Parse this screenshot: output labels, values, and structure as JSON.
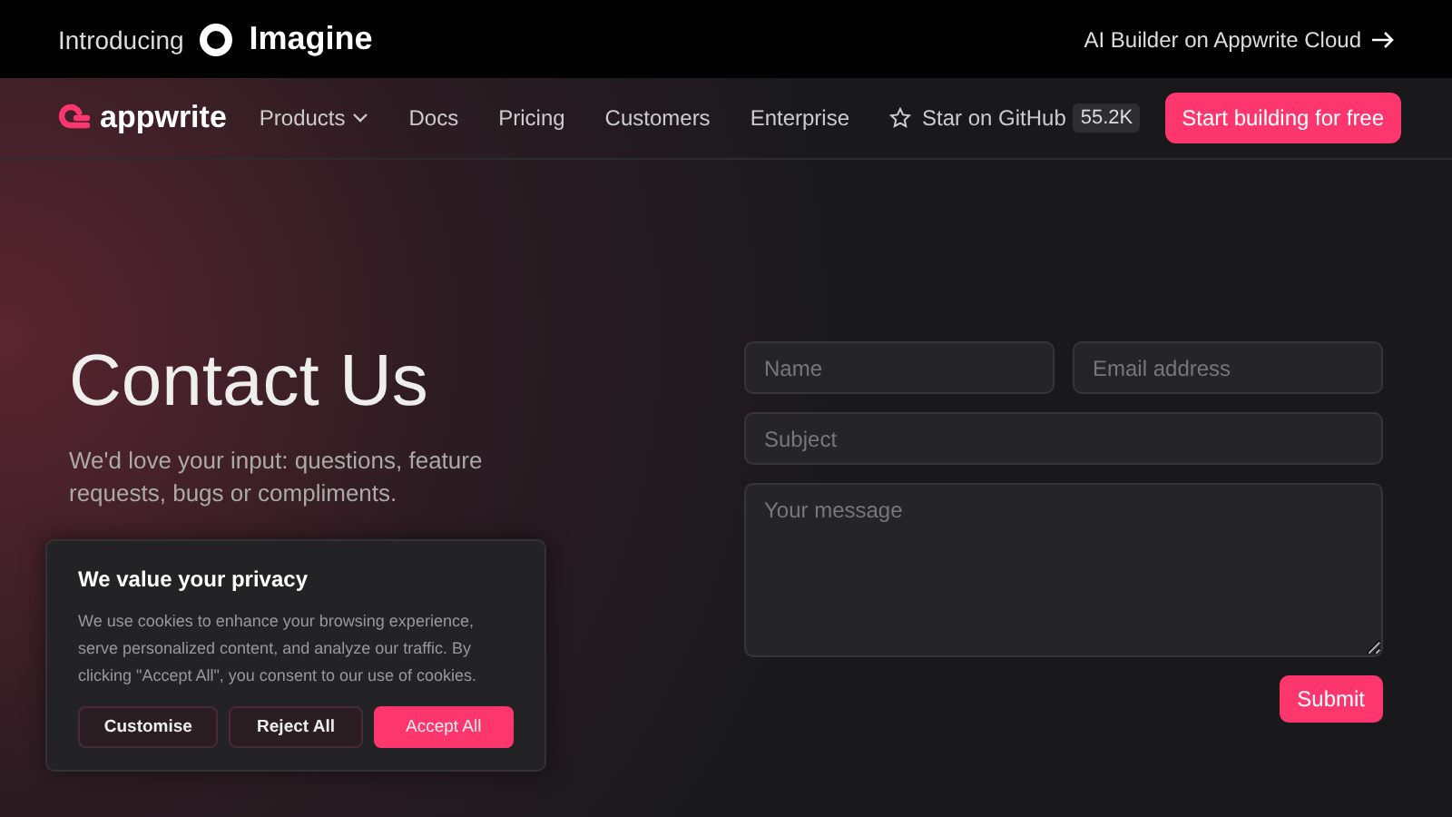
{
  "announcement": {
    "intro": "Introducing",
    "product": "Imagine",
    "link": "AI Builder on Appwrite Cloud"
  },
  "nav": {
    "logo": "appwrite",
    "items": [
      {
        "label": "Products",
        "dropdown": true
      },
      {
        "label": "Docs",
        "dropdown": false
      },
      {
        "label": "Pricing",
        "dropdown": false
      },
      {
        "label": "Customers",
        "dropdown": false
      },
      {
        "label": "Enterprise",
        "dropdown": false
      }
    ],
    "github": {
      "label": "Star on GitHub",
      "count": "55.2K"
    },
    "cta": "Start building for free"
  },
  "hero": {
    "title": "Contact Us",
    "subtitle": "We'd love your input: questions, feature requests, bugs or compliments."
  },
  "form": {
    "fields": [
      {
        "kind": "input",
        "placeholder": "Name"
      },
      {
        "kind": "input",
        "placeholder": "Email address"
      },
      {
        "kind": "input",
        "placeholder": "Subject"
      },
      {
        "kind": "textarea",
        "placeholder": "Your message"
      }
    ],
    "submit": "Submit"
  },
  "cookie_banner": {
    "title": "We value your privacy",
    "text": "We use cookies to enhance your browsing experience, serve personalized content, and analyze our traffic. By clicking \"Accept All\", you consent to our use of cookies.",
    "buttons": [
      {
        "label": "Customise",
        "kind": "secondary"
      },
      {
        "label": "Reject All",
        "kind": "secondary"
      },
      {
        "label": "Accept All",
        "kind": "primary"
      }
    ]
  }
}
